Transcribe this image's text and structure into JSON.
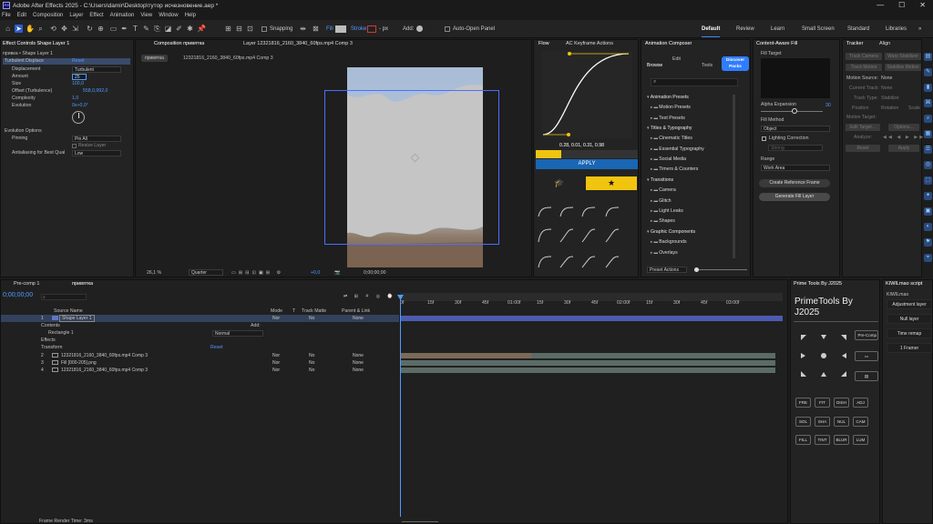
{
  "window": {
    "title": "Adobe After Effects 2025 - C:\\Users\\damir\\Desktop\\тутор исчезновение.aep *"
  },
  "menu": [
    "File",
    "Edit",
    "Composition",
    "Layer",
    "Effect",
    "Animation",
    "View",
    "Window",
    "Help"
  ],
  "toolbar": {
    "snapping": "Snapping",
    "fill": "Fill",
    "stroke": "Stroke:",
    "stroke_px": "- px",
    "add": "Add:",
    "auto_open": "Auto-Open Panel",
    "workspaces": [
      "Default",
      "Review",
      "Learn",
      "Small Screen",
      "Standard",
      "Libraries"
    ]
  },
  "effect_controls": {
    "tab": "Effect Controls Shape Layer 1",
    "subtitle": "привка • Shape Layer 1",
    "effect_name": "Turbulent Displace",
    "reset": "Reset",
    "props": [
      {
        "name": "Displacement",
        "value": "Turbulent"
      },
      {
        "name": "Amount",
        "value": "25"
      },
      {
        "name": "Size",
        "value": "100,0"
      },
      {
        "name": "Offset (Turbulence)",
        "value": "558,0,992,0"
      },
      {
        "name": "Complexity",
        "value": "1,0"
      },
      {
        "name": "Evolution",
        "value": "0x+0,0°"
      }
    ],
    "evolution_options": "Evolution Options",
    "pinning": {
      "name": "Pinning",
      "value": "Pin All"
    },
    "resize_layer": "Resize Layer",
    "antialiasing": {
      "name": "Antialiasing for Best Qual",
      "value": "Low"
    }
  },
  "composition": {
    "tab": "Composition привятка",
    "layer_tab": "Layer 12321816_2160_3840_60fps.mp4 Comp 3",
    "crumb1": "привятка",
    "crumb2": "12321816_2160_3840_60fps.mp4 Comp 3",
    "zoom": "26,1 %",
    "quality": "Quarter",
    "exposure": "+0,0",
    "timecode": "0;00;00;00"
  },
  "flow": {
    "tab1": "Flow",
    "tab2": "AC Keyframe Actions",
    "bezier": "0.28, 0.01, 0.31, 0.98",
    "apply": "APPLY"
  },
  "anim_composer": {
    "tab": "Animation Composer",
    "tabs": [
      "Browse",
      "Edit",
      "Tools"
    ],
    "discover": "Discover Packs",
    "groups": [
      {
        "name": "Animation Presets",
        "items": [
          "Motion Presets",
          "Text Presets"
        ]
      },
      {
        "name": "Titles & Typography",
        "items": [
          "Cinematic Titles",
          "Essential Typography",
          "Social Media",
          "Timers & Counters"
        ]
      },
      {
        "name": "Transitions",
        "items": [
          "Camera",
          "Glitch",
          "Light Leaks",
          "Shapes"
        ]
      },
      {
        "name": "Graphic Components",
        "items": [
          "Backgrounds",
          "Overlays"
        ]
      }
    ],
    "preset_actions": "Preset Actions"
  },
  "content_aware": {
    "tab": "Content-Aware Fill",
    "fill_target": "Fill Target",
    "alpha_expansion": "Alpha Expansion",
    "alpha_value": "30",
    "fill_method": "Fill Method",
    "method_value": "Object",
    "lighting": "Lighting Correction",
    "strong": "Strong",
    "range": "Range",
    "range_value": "Work Area",
    "create_ref": "Create Reference Frame",
    "generate": "Generate Fill Layer"
  },
  "tracker": {
    "tab": "Tracker",
    "tab2": "Align",
    "btns": [
      "Track Camera",
      "Warp Stabilizer",
      "Track Motion",
      "Stabilize Motion"
    ],
    "motion_source": "Motion Source:",
    "motion_source_value": "None",
    "current_track": "Current Track:",
    "current_track_value": "None",
    "track_type": "Track Type:",
    "track_type_value": "Stabilize",
    "position": "Position",
    "rotation": "Rotation",
    "scale": "Scale",
    "motion_target": "Motion Target:",
    "edit_target": "Edit Target...",
    "options": "Options...",
    "analyze": "Analyze:",
    "reset": "Reset",
    "apply": "Apply"
  },
  "timeline": {
    "tab1": "Pre-comp 1",
    "tab2": "привятка",
    "timecode": "0;00;00;00",
    "cols": [
      "Source Name",
      "Mode",
      "T",
      "Track Matte",
      "Parent & Link"
    ],
    "ruler": [
      "0f",
      "15f",
      "30f",
      "45f",
      "01:00f",
      "15f",
      "30f",
      "45f",
      "02:00f",
      "15f",
      "30f",
      "45f",
      "03:00f"
    ],
    "layers": [
      {
        "num": "1",
        "name": "Shape Layer 1",
        "mode": "Nor",
        "matte": "No",
        "parent": "None"
      },
      {
        "num": "2",
        "name": "12321816_2160_3840_60fps.mp4 Comp 3",
        "mode": "Nor",
        "matte": "No",
        "parent": "None"
      },
      {
        "num": "3",
        "name": "Fill [000-205].png",
        "mode": "Nor",
        "matte": "No",
        "parent": "None"
      },
      {
        "num": "4",
        "name": "12321816_2160_3840_60fps.mp4 Comp 3",
        "mode": "Nor",
        "matte": "No",
        "parent": "None"
      }
    ],
    "contents": "Contents",
    "add": "Add:",
    "rectangle": "Rectangle 1",
    "normal": "Normal",
    "effects": "Effects",
    "transform": "Transform",
    "reset": "Reset",
    "render_time": "Frame Render Time: 3ms"
  },
  "primetools": {
    "tab": "Prime Tools By J2025",
    "title": "PrimeTools By J2025",
    "precomp": "Pre-Comp",
    "buttons": [
      "FRE",
      "FIT",
      "DISH",
      "ADJ",
      "SOL",
      "SHA",
      "NUL",
      "CAM",
      "FILL",
      "TINT",
      "BLUR",
      "LUM"
    ]
  },
  "kiwil": {
    "tab": "KIWILmao script",
    "label": "KIWILmao",
    "buttons": [
      "Adjustment layer",
      "Null layer",
      "Time remap",
      "1 Framer"
    ]
  }
}
